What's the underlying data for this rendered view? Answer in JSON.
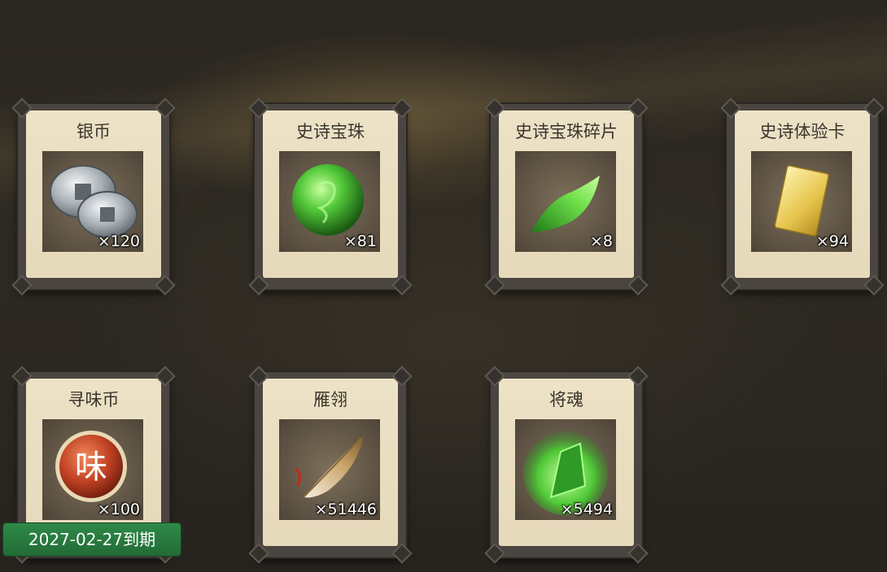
{
  "items": [
    {
      "name": "银币",
      "qty": "×120",
      "icon": "silver-coins-icon"
    },
    {
      "name": "史诗宝珠",
      "qty": "×81",
      "icon": "green-orb-icon"
    },
    {
      "name": "史诗宝珠碎片",
      "qty": "×8",
      "icon": "green-shard-icon"
    },
    {
      "name": "史诗体验卡",
      "qty": "×94",
      "icon": "gold-card-icon"
    },
    {
      "name": "寻味币",
      "qty": "×100",
      "icon": "red-coin-icon"
    },
    {
      "name": "雁翎",
      "qty": "×51446",
      "icon": "feather-icon"
    },
    {
      "name": "将魂",
      "qty": "×5494",
      "icon": "green-crystal-icon"
    }
  ],
  "expiry_label": "2027-02-27到期",
  "red_coin_char": "味"
}
